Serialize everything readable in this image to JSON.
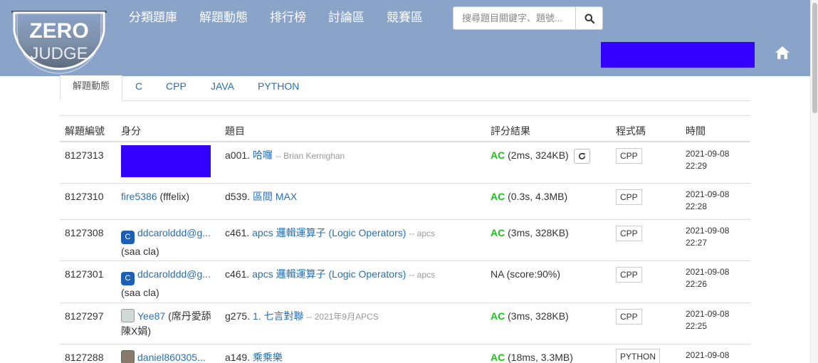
{
  "logo": {
    "line1": "ZERO",
    "line2": "JUDGE"
  },
  "nav": [
    {
      "label": "分類題庫"
    },
    {
      "label": "解題動態"
    },
    {
      "label": "排行榜"
    },
    {
      "label": "討論區"
    },
    {
      "label": "競賽區"
    }
  ],
  "search": {
    "placeholder": "搜尋題目關鍵字、題號..."
  },
  "colors": {
    "navbar": "#8aa3c8",
    "ac": "#1fc11f",
    "link": "#2a6fb0",
    "redacted": "#3300ff"
  },
  "tabs": [
    {
      "label": "解題動態",
      "active": true
    },
    {
      "label": "C"
    },
    {
      "label": "CPP"
    },
    {
      "label": "JAVA"
    },
    {
      "label": "PYTHON"
    }
  ],
  "table": {
    "headers": [
      "解題編號",
      "身分",
      "題目",
      "評分結果",
      "程式碼",
      "時間"
    ],
    "rows": [
      {
        "id": "8127313",
        "user": "",
        "user_sub": "",
        "pid": "a001.",
        "ptitle": "哈囉",
        "psource": "-- Brian Kernighan",
        "verdict": "AC",
        "detail": "(2ms, 324KB)",
        "lang": "CPP",
        "date": "2021-09-08",
        "clock": "22:29"
      },
      {
        "id": "8127310",
        "user": "fire5386",
        "user_sub": "(fffelix)",
        "pid": "d539.",
        "ptitle": "區間 MAX",
        "psource": "",
        "verdict": "AC",
        "detail": "(0.3s, 4.3MB)",
        "lang": "CPP",
        "date": "2021-09-08",
        "clock": "22:28"
      },
      {
        "id": "8127308",
        "user": "ddcarolddd@g...",
        "user_sub": "(saa cla)",
        "pid": "c461.",
        "ptitle": "apcs 邏輯運算子 (Logic Operators)",
        "psource": "-- apcs",
        "verdict": "AC",
        "detail": "(3ms, 328KB)",
        "lang": "CPP",
        "date": "2021-09-08",
        "clock": "22:27"
      },
      {
        "id": "8127301",
        "user": "ddcarolddd@g...",
        "user_sub": "(saa cla)",
        "pid": "c461.",
        "ptitle": "apcs 邏輯運算子 (Logic Operators)",
        "psource": "-- apcs",
        "verdict": "NA",
        "detail": "NA (score:90%)",
        "lang": "CPP",
        "date": "2021-09-08",
        "clock": "22:26"
      },
      {
        "id": "8127297",
        "user": "Yee87",
        "user_sub": "(席丹愛舔陳X娟)",
        "pid": "g275.",
        "ptitle": "1. 七言對聯",
        "psource": "-- 2021年9月APCS",
        "verdict": "AC",
        "detail": "(3ms, 328KB)",
        "lang": "CPP",
        "date": "2021-09-08",
        "clock": "22:25"
      },
      {
        "id": "8127288",
        "user": "daniel860305...",
        "user_sub": "",
        "pid": "a149.",
        "ptitle": "乘乘樂",
        "psource": "",
        "verdict": "AC",
        "detail": "(18ms, 3.3MB)",
        "lang": "PYTHON",
        "date": "2021-09-08",
        "clock": ""
      }
    ]
  },
  "avatar_letter": "C"
}
